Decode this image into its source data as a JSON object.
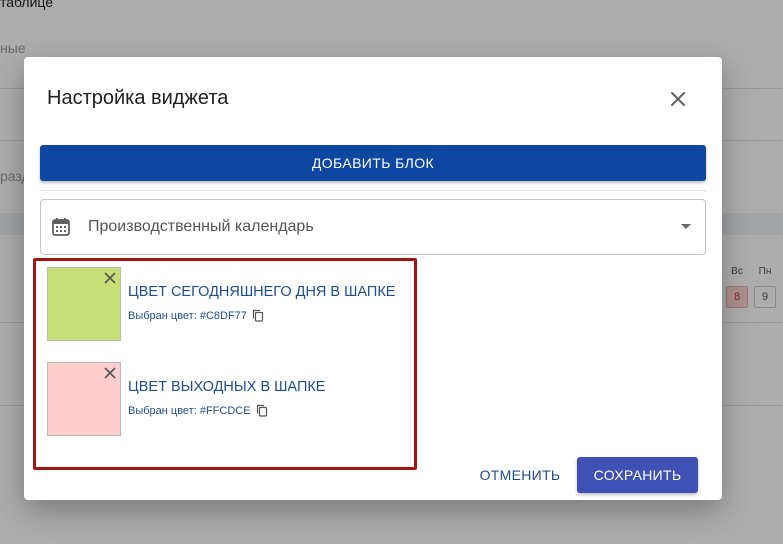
{
  "background": {
    "title": "таблице",
    "subtitle": "ные",
    "hint": "разд",
    "calendar": {
      "days": [
        {
          "name": "Вс",
          "num": "8",
          "holiday": true
        },
        {
          "name": "Пн",
          "num": "9",
          "holiday": false
        }
      ]
    }
  },
  "dialog": {
    "title": "Настройка виджета",
    "close_icon": "close-icon",
    "add_block_label": "ДОБАВИТЬ БЛОК",
    "select": {
      "icon": "calendar-icon",
      "value": "Производственный календарь"
    },
    "colors": [
      {
        "label": "ЦВЕТ СЕГОДНЯШНЕГО ДНЯ В ШАПКЕ",
        "selected": "Выбран цвет: #C8DF77",
        "color": "#C8DF77"
      },
      {
        "label": "ЦВЕТ ВЫХОДНЫХ В ШАПКЕ",
        "selected": "Выбран цвет: #FFCDCE",
        "color": "#FFCDCE"
      }
    ],
    "cancel_label": "ОТМЕНИТЬ",
    "save_label": "СОХРАНИТЬ"
  },
  "colors": {
    "primary_button": "#0D47A1",
    "save_button": "#3F51B5",
    "highlight_border": "#A31515",
    "link_text": "#1F4E8C"
  }
}
